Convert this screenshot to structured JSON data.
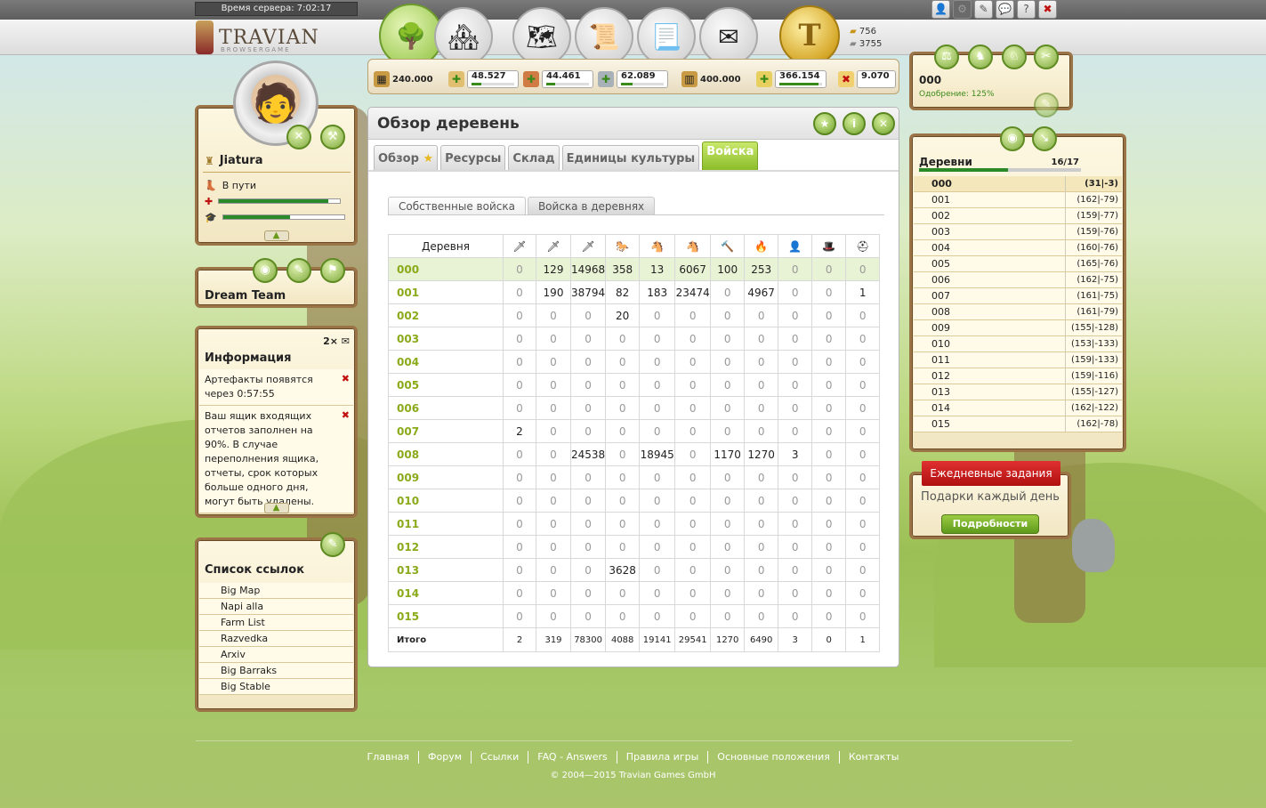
{
  "server_time": "Время сервера: 7:02:17",
  "logo": {
    "name": "TRAVIAN",
    "sub": "BROWSERGAME"
  },
  "gold_coin": "T",
  "currency": {
    "gold": "756",
    "silver": "3755"
  },
  "resources": {
    "warehouse": "240.000",
    "wood": "48.527",
    "clay": "44.461",
    "iron": "62.089",
    "granary": "400.000",
    "crop": "366.154",
    "consumption": "9.070"
  },
  "player": {
    "name": "Jiatura",
    "status": "В пути",
    "alliance": "Dream Team"
  },
  "info": {
    "title": "Информация",
    "count": "2×",
    "messages": [
      "Артефакты появятся через 0:57:55",
      "Ваш ящик входящих отчетов заполнен на 90%. В случае переполнения ящика, отчеты, срок которых больше одного дня, могут быть удалены."
    ]
  },
  "links": {
    "title": "Список ссылок",
    "items": [
      "Big Map",
      "Napi alla",
      "Farm List",
      "Razvedka",
      "Arxiv",
      "Big Barraks",
      "Big Stable"
    ]
  },
  "main": {
    "title": "Обзор деревень",
    "tabs": [
      "Обзор",
      "Ресурсы",
      "Склад",
      "Единицы культуры",
      "Войска"
    ],
    "subtabs": [
      "Собственные войска",
      "Войска в деревнях"
    ],
    "column_header": "Деревня",
    "total_label": "Итого",
    "unit_icons": [
      "🗡",
      "🗡",
      "🗡",
      "🐎",
      "🐴",
      "🐴",
      "🔨",
      "🔥",
      "👤",
      "🎩",
      "⛑"
    ],
    "rows": [
      {
        "name": "000",
        "values": [
          "0",
          "129",
          "14968",
          "358",
          "13",
          "6067",
          "100",
          "253",
          "0",
          "0",
          "0"
        ]
      },
      {
        "name": "001",
        "values": [
          "0",
          "190",
          "38794",
          "82",
          "183",
          "23474",
          "0",
          "4967",
          "0",
          "0",
          "1"
        ]
      },
      {
        "name": "002",
        "values": [
          "0",
          "0",
          "0",
          "20",
          "0",
          "0",
          "0",
          "0",
          "0",
          "0",
          "0"
        ]
      },
      {
        "name": "003",
        "values": [
          "0",
          "0",
          "0",
          "0",
          "0",
          "0",
          "0",
          "0",
          "0",
          "0",
          "0"
        ]
      },
      {
        "name": "004",
        "values": [
          "0",
          "0",
          "0",
          "0",
          "0",
          "0",
          "0",
          "0",
          "0",
          "0",
          "0"
        ]
      },
      {
        "name": "005",
        "values": [
          "0",
          "0",
          "0",
          "0",
          "0",
          "0",
          "0",
          "0",
          "0",
          "0",
          "0"
        ]
      },
      {
        "name": "006",
        "values": [
          "0",
          "0",
          "0",
          "0",
          "0",
          "0",
          "0",
          "0",
          "0",
          "0",
          "0"
        ]
      },
      {
        "name": "007",
        "values": [
          "2",
          "0",
          "0",
          "0",
          "0",
          "0",
          "0",
          "0",
          "0",
          "0",
          "0"
        ]
      },
      {
        "name": "008",
        "values": [
          "0",
          "0",
          "24538",
          "0",
          "18945",
          "0",
          "1170",
          "1270",
          "3",
          "0",
          "0"
        ]
      },
      {
        "name": "009",
        "values": [
          "0",
          "0",
          "0",
          "0",
          "0",
          "0",
          "0",
          "0",
          "0",
          "0",
          "0"
        ]
      },
      {
        "name": "010",
        "values": [
          "0",
          "0",
          "0",
          "0",
          "0",
          "0",
          "0",
          "0",
          "0",
          "0",
          "0"
        ]
      },
      {
        "name": "011",
        "values": [
          "0",
          "0",
          "0",
          "0",
          "0",
          "0",
          "0",
          "0",
          "0",
          "0",
          "0"
        ]
      },
      {
        "name": "012",
        "values": [
          "0",
          "0",
          "0",
          "0",
          "0",
          "0",
          "0",
          "0",
          "0",
          "0",
          "0"
        ]
      },
      {
        "name": "013",
        "values": [
          "0",
          "0",
          "0",
          "3628",
          "0",
          "0",
          "0",
          "0",
          "0",
          "0",
          "0"
        ]
      },
      {
        "name": "014",
        "values": [
          "0",
          "0",
          "0",
          "0",
          "0",
          "0",
          "0",
          "0",
          "0",
          "0",
          "0"
        ]
      },
      {
        "name": "015",
        "values": [
          "0",
          "0",
          "0",
          "0",
          "0",
          "0",
          "0",
          "0",
          "0",
          "0",
          "0"
        ]
      }
    ],
    "totals": [
      "2",
      "319",
      "78300",
      "4088",
      "19141",
      "29541",
      "1270",
      "6490",
      "3",
      "0",
      "1"
    ]
  },
  "current_village": {
    "name": "000",
    "approval": "Одобрение: 125%"
  },
  "villages": {
    "title": "Деревни",
    "count": "16/17",
    "items": [
      {
        "name": "000",
        "coord": "(31|-3)"
      },
      {
        "name": "001",
        "coord": "(162|-79)"
      },
      {
        "name": "002",
        "coord": "(159|-77)"
      },
      {
        "name": "003",
        "coord": "(159|-76)"
      },
      {
        "name": "004",
        "coord": "(160|-76)"
      },
      {
        "name": "005",
        "coord": "(165|-76)"
      },
      {
        "name": "006",
        "coord": "(162|-75)"
      },
      {
        "name": "007",
        "coord": "(161|-75)"
      },
      {
        "name": "008",
        "coord": "(161|-79)"
      },
      {
        "name": "009",
        "coord": "(155|-128)"
      },
      {
        "name": "010",
        "coord": "(153|-133)"
      },
      {
        "name": "011",
        "coord": "(159|-133)"
      },
      {
        "name": "012",
        "coord": "(159|-116)"
      },
      {
        "name": "013",
        "coord": "(155|-127)"
      },
      {
        "name": "014",
        "coord": "(162|-122)"
      },
      {
        "name": "015",
        "coord": "(162|-78)"
      }
    ]
  },
  "daily": {
    "tag": "Ежедневные задания",
    "text": "Подарки каждый день",
    "button": "Подробности"
  },
  "footer": {
    "links": [
      "Главная",
      "Форум",
      "Ссылки",
      "FAQ - Answers",
      "Правила игры",
      "Основные положения",
      "Контакты"
    ],
    "copyright": "© 2004—2015 Travian Games GmbH"
  }
}
